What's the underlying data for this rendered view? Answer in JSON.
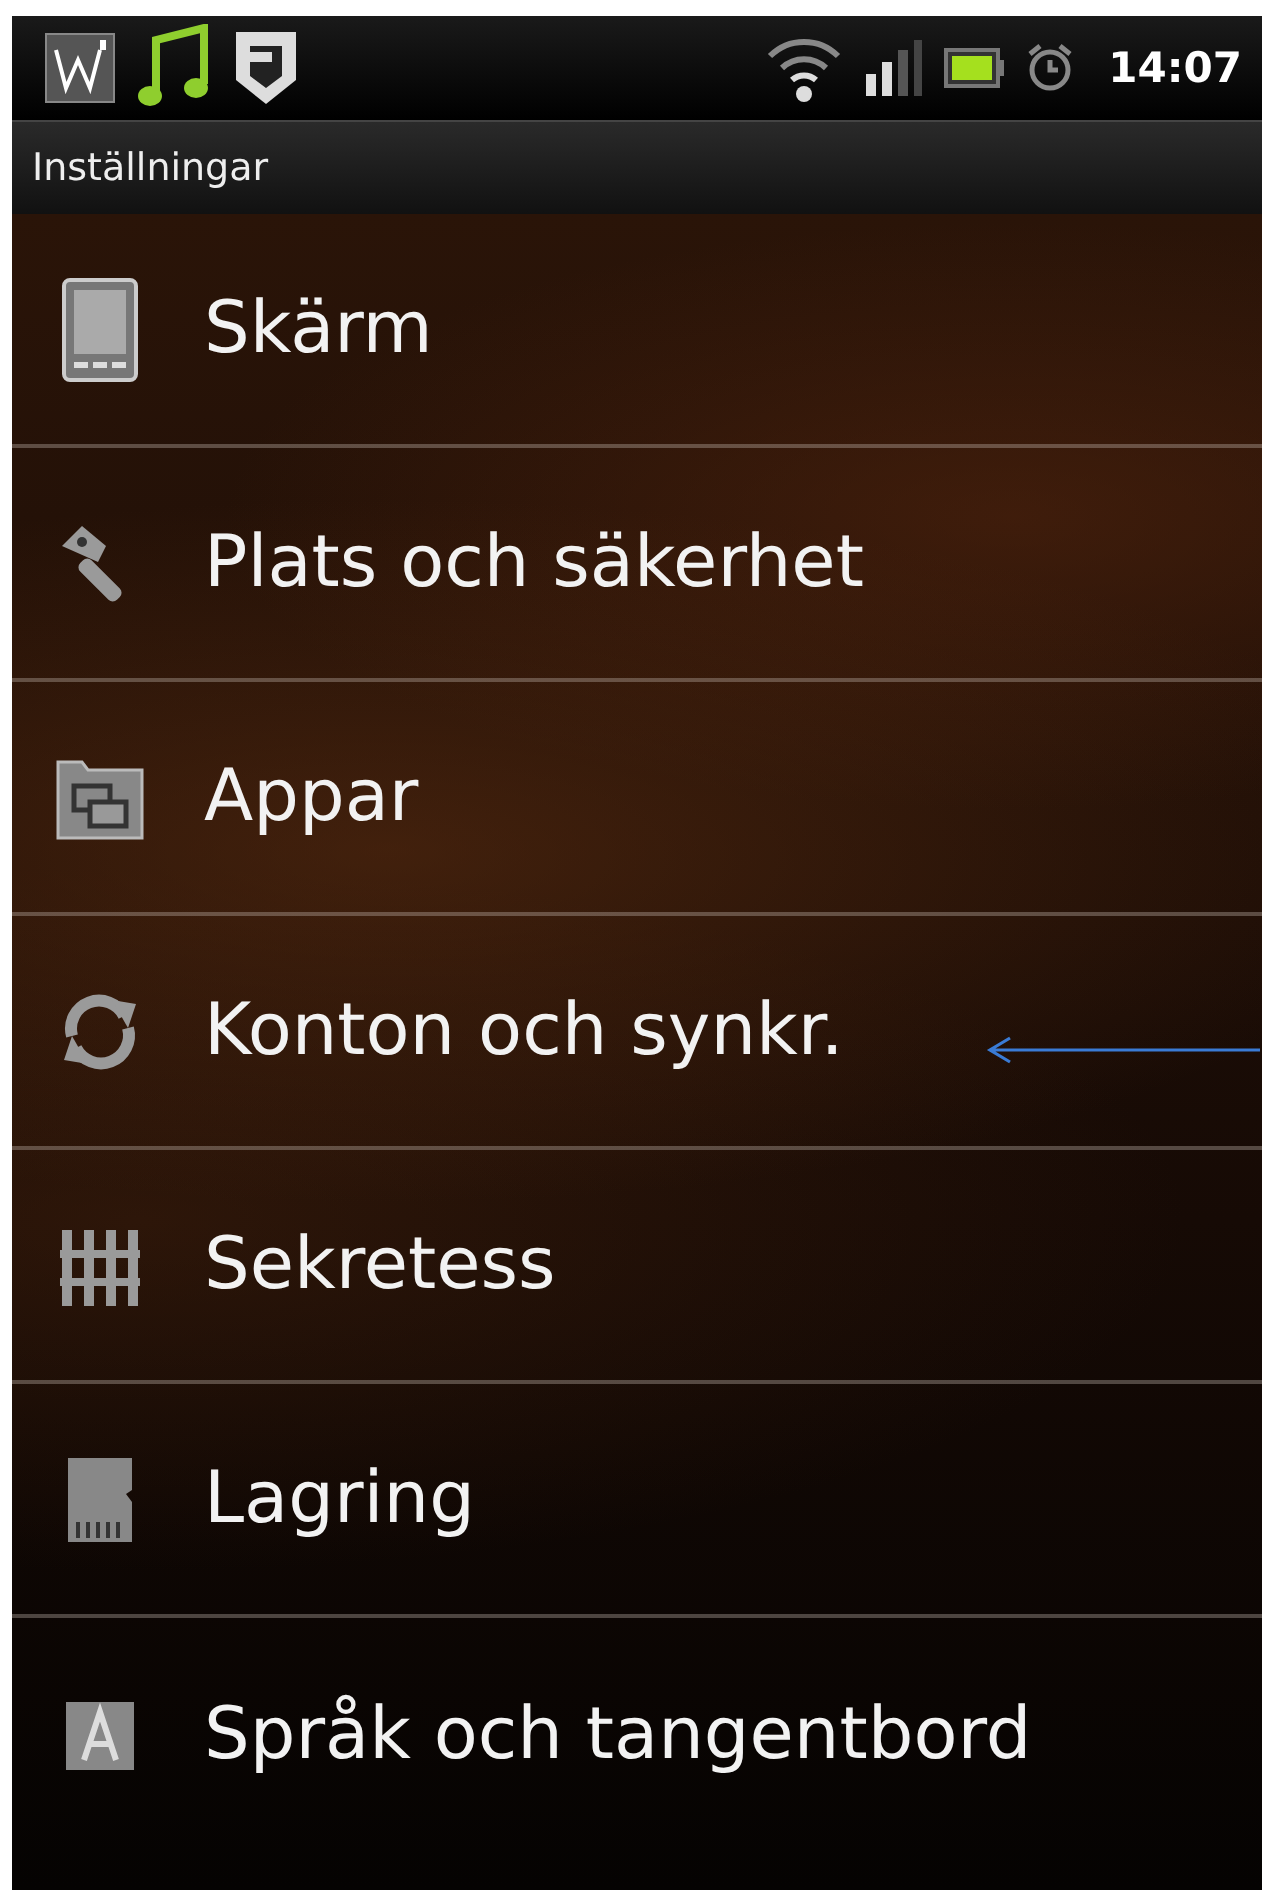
{
  "status_bar": {
    "time": "14:07"
  },
  "title_bar": {
    "title": "Inställningar"
  },
  "settings": [
    {
      "label": "Skärm",
      "marked": false
    },
    {
      "label": "Plats och säkerhet",
      "marked": false
    },
    {
      "label": "Appar",
      "marked": false
    },
    {
      "label": "Konton och synkr.",
      "marked": true
    },
    {
      "label": "Sekretess",
      "marked": false
    },
    {
      "label": "Lagring",
      "marked": false
    },
    {
      "label": "Språk och tangentbord",
      "marked": false
    }
  ]
}
